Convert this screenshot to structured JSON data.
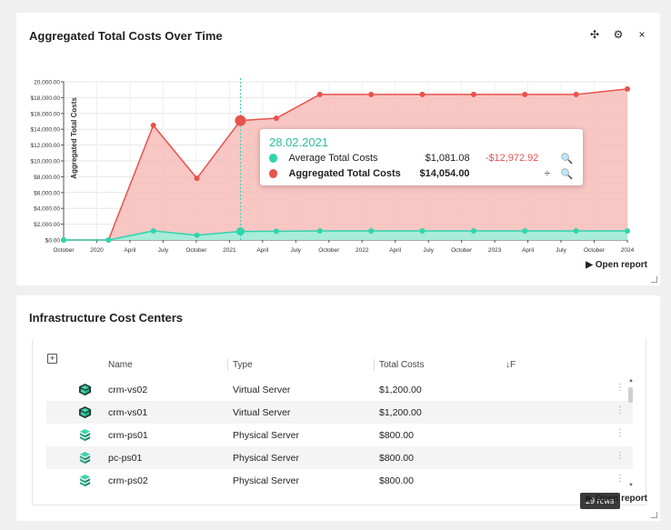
{
  "chart_panel": {
    "title": "Aggregated Total Costs Over Time",
    "move_label": "✣",
    "settings_label": "⚙",
    "close_label": "×",
    "open_report": "▶ Open report"
  },
  "tooltip": {
    "date": "28.02.2021",
    "rows": [
      {
        "name": "Average Total Costs",
        "value": "$1,081.08",
        "diff": "-$12,972.92",
        "search_icon": "🔍",
        "pin_icon": ""
      },
      {
        "name": "Aggregated Total Costs",
        "value": "$14,054.00",
        "diff": "",
        "search_icon": "🔍",
        "pin_icon": "÷"
      }
    ]
  },
  "chart_data": {
    "type": "area",
    "ylabel": "Aggregated Total Costs",
    "ylim": [
      0,
      20000
    ],
    "yticks": [
      "$0.00",
      "$2,000.00",
      "$4,000.00",
      "$6,000.00",
      "$8,000.00",
      "$10,000.00",
      "$12,000.00",
      "$14,000.00",
      "$16,000.00",
      "$18,000.00",
      "20,000.00"
    ],
    "xticks": [
      "October",
      "2020",
      "April",
      "July",
      "October",
      "2021",
      "April",
      "July",
      "October",
      "2022",
      "April",
      "July",
      "October",
      "2023",
      "April",
      "July",
      "October",
      "2024"
    ],
    "series": [
      {
        "name": "Aggregated Total Costs",
        "color": "#e8534d",
        "values": [
          0,
          0,
          14500,
          7800,
          15100,
          15400,
          18400,
          18400,
          18400,
          18400,
          18400,
          18400,
          19100
        ]
      },
      {
        "name": "Average Total Costs",
        "color": "#2fd5ae",
        "values": [
          0,
          0,
          1150,
          600,
          1081,
          1100,
          1150,
          1150,
          1150,
          1150,
          1150,
          1150,
          1150
        ]
      }
    ],
    "colors": {
      "red": "#e8534d",
      "red_fill": "#f7bcb8",
      "teal": "#2fd5ae",
      "teal_fill": "#a8ecd9"
    }
  },
  "table_panel": {
    "title": "Infrastructure Cost Centers",
    "add_icon": "+",
    "columns": [
      "Name",
      "Type",
      "Total Costs",
      "↓F"
    ],
    "rows": [
      {
        "name": "crm-vs02",
        "type": "Virtual Server",
        "cost": "$1,200.00",
        "icon": "virtual-server-icon"
      },
      {
        "name": "crm-vs01",
        "type": "Virtual Server",
        "cost": "$1,200.00",
        "icon": "virtual-server-icon"
      },
      {
        "name": "crm-ps01",
        "type": "Physical Server",
        "cost": "$800.00",
        "icon": "physical-server-icon"
      },
      {
        "name": "pc-ps01",
        "type": "Physical Server",
        "cost": "$800.00",
        "icon": "physical-server-icon"
      },
      {
        "name": "crm-ps02",
        "type": "Physical Server",
        "cost": "$800.00",
        "icon": "physical-server-icon"
      }
    ],
    "menu": "⋮",
    "row_count_badge": "29 rows",
    "scroll_up": "▲",
    "scroll_down": "▼",
    "open_report": "▶ Open report"
  }
}
